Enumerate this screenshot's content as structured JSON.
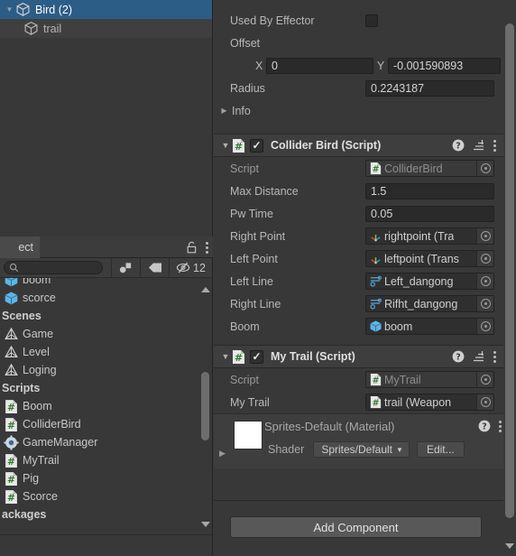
{
  "hierarchy": {
    "rows": [
      {
        "label": "Bird (2)",
        "selected": true,
        "expanded": true,
        "icon": "cube-icon"
      },
      {
        "label": "trail",
        "selected": false,
        "child": true,
        "icon": "cube-icon"
      }
    ]
  },
  "project": {
    "tab_label": "ect",
    "lock_icon": "lock-icon",
    "menu_icon": "kebab-menu-icon",
    "search_placeholder": "",
    "search_value": "",
    "search_icon": "search-icon",
    "filter_type_icon": "filter-by-type-icon",
    "filter_label_icon": "filter-by-label-icon",
    "hidden_count": "12",
    "hidden_icon": "visibility-off-icon",
    "items": [
      {
        "label": "boom",
        "icon": "prefab-icon",
        "kind": "asset",
        "clipped": true
      },
      {
        "label": "scorce",
        "icon": "prefab-icon",
        "kind": "asset"
      },
      {
        "label": "Scenes",
        "icon": "none",
        "kind": "folder"
      },
      {
        "label": "Game",
        "icon": "scene-icon",
        "kind": "asset"
      },
      {
        "label": "Level",
        "icon": "scene-icon",
        "kind": "asset"
      },
      {
        "label": "Loging",
        "icon": "scene-icon",
        "kind": "asset"
      },
      {
        "label": "Scripts",
        "icon": "none",
        "kind": "folder"
      },
      {
        "label": "Boom",
        "icon": "script-icon",
        "kind": "asset"
      },
      {
        "label": "ColliderBird",
        "icon": "script-icon",
        "kind": "asset"
      },
      {
        "label": "GameManager",
        "icon": "gear-icon",
        "kind": "asset"
      },
      {
        "label": "MyTrail",
        "icon": "script-icon",
        "kind": "asset"
      },
      {
        "label": "Pig",
        "icon": "script-icon",
        "kind": "asset"
      },
      {
        "label": "Scorce",
        "icon": "script-icon",
        "kind": "asset"
      },
      {
        "label": "ackages",
        "icon": "none",
        "kind": "folder"
      }
    ]
  },
  "inspector": {
    "collider2d": {
      "cut_off_label": "",
      "used_by_effector_label": "Used By Effector",
      "used_by_effector_checked": false,
      "offset_label": "Offset",
      "offset_x_label": "X",
      "offset_x_value": "0",
      "offset_y_label": "Y",
      "offset_y_value": "-0.001590893",
      "radius_label": "Radius",
      "radius_value": "0.2243187",
      "info_label": "Info"
    },
    "collider_bird": {
      "title": "Collider Bird (Script)",
      "enabled": true,
      "expanded": true,
      "help_icon": "help-icon",
      "preset_icon": "preset-icon",
      "menu_icon": "kebab-menu-icon",
      "script_icon": "cs-script-icon",
      "rows": [
        {
          "label": "Script",
          "type": "object",
          "value": "ColliderBird",
          "icon": "cs-script-icon",
          "dim": true
        },
        {
          "label": "Max Distance",
          "type": "number",
          "value": "1.5"
        },
        {
          "label": "Pw Time",
          "type": "number",
          "value": "0.05"
        },
        {
          "label": "Right Point",
          "type": "object",
          "value": "rightpoint (Tra",
          "icon": "transform-icon"
        },
        {
          "label": "Left Point",
          "type": "object",
          "value": "leftpoint (Trans",
          "icon": "transform-icon"
        },
        {
          "label": "Left Line",
          "type": "object",
          "value": "Left_dangong ",
          "icon": "linerenderer-icon"
        },
        {
          "label": "Right Line",
          "type": "object",
          "value": "Rifht_dangong",
          "icon": "linerenderer-icon"
        },
        {
          "label": "Boom",
          "type": "object",
          "value": "boom",
          "icon": "prefab-icon"
        }
      ]
    },
    "my_trail": {
      "title": "My Trail (Script)",
      "enabled": true,
      "expanded": true,
      "help_icon": "help-icon",
      "preset_icon": "preset-icon",
      "menu_icon": "kebab-menu-icon",
      "script_icon": "cs-script-icon",
      "rows": [
        {
          "label": "Script",
          "type": "object",
          "value": "MyTrail",
          "icon": "cs-script-icon",
          "dim": true
        },
        {
          "label": "My Trail",
          "type": "object",
          "value": "trail (Weapon ",
          "icon": "cs-script-icon"
        }
      ]
    },
    "material": {
      "title": "Sprites-Default (Material)",
      "help_icon": "help-icon",
      "menu_icon": "kebab-menu-icon",
      "expand_icon": "triangle-right-icon",
      "swatch_color": "#ffffff",
      "shader_label": "Shader",
      "shader_value": "Sprites/Default",
      "edit_label": "Edit..."
    },
    "add_component_label": "Add Component"
  },
  "colors": {
    "panel_bg": "#383838",
    "header_bg": "#3e3e3e",
    "selection_blue": "#2c5d87",
    "field_bg": "#2a2a2a",
    "text": "#c4c4c4",
    "script_green": "#3f7a3f",
    "prefab_blue": "#5bb5e8"
  }
}
